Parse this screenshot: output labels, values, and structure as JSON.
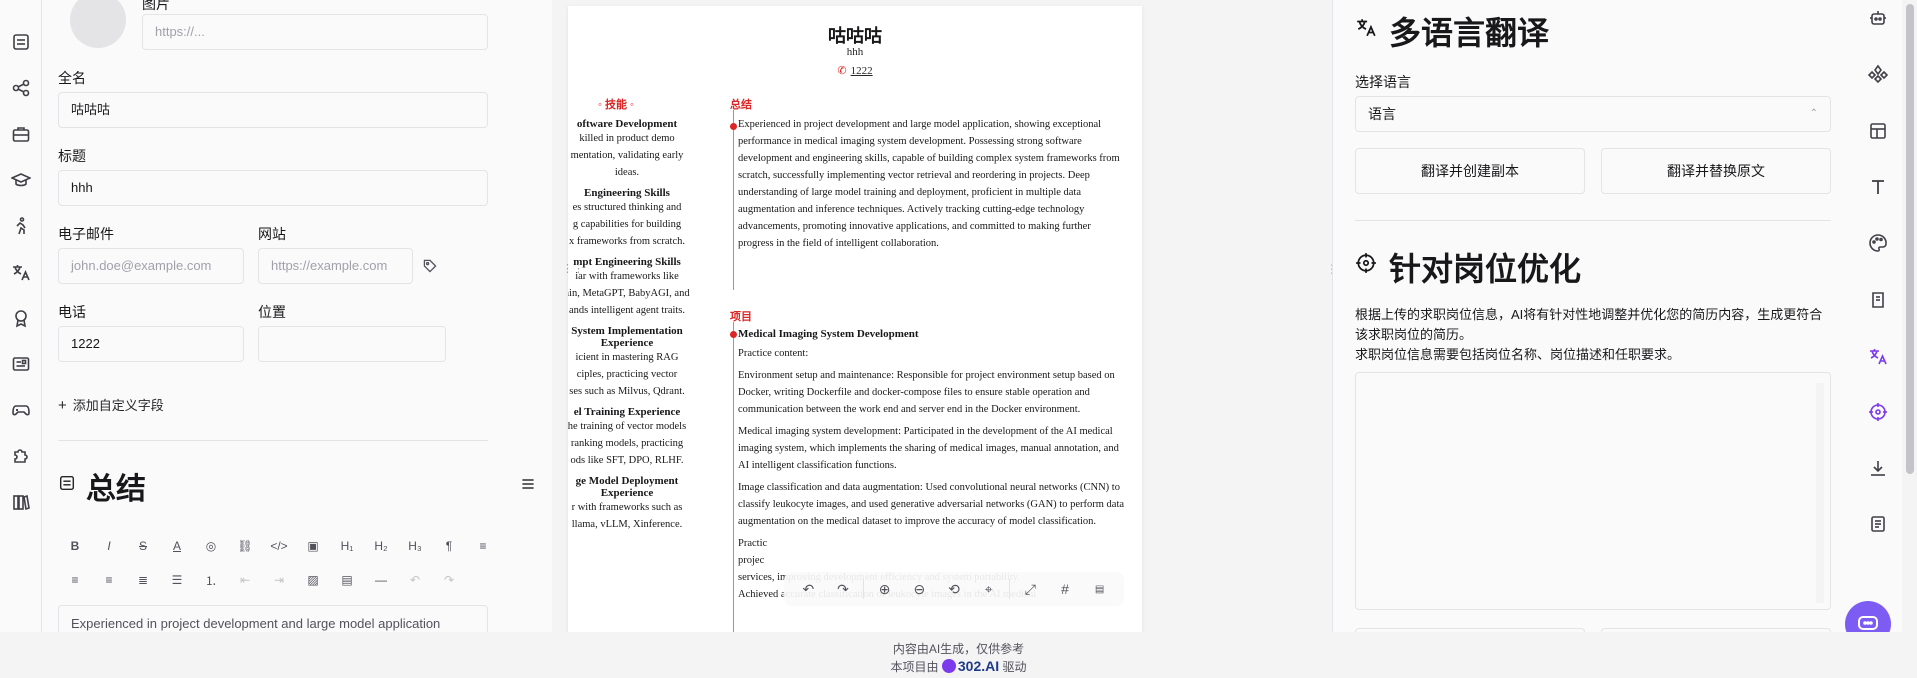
{
  "left_rail": {
    "icons": [
      "list-icon",
      "share-icon",
      "briefcase-icon",
      "graduation-cap-icon",
      "person-run-icon",
      "translate-icon",
      "award-icon",
      "news-icon",
      "gamepad-icon",
      "puzzle-icon",
      "books-icon"
    ]
  },
  "editor": {
    "image_label": "图片",
    "image_url_placeholder": "https://...",
    "fullname_label": "全名",
    "fullname_value": "咕咕咕",
    "title_label": "标题",
    "title_value": "hhh",
    "email_label": "电子邮件",
    "email_placeholder": "john.doe@example.com",
    "website_label": "网站",
    "website_placeholder": "https://example.com",
    "phone_label": "电话",
    "phone_value": "1222",
    "location_label": "位置",
    "location_value": "",
    "add_custom_field": "添加自定义字段",
    "summary_title": "总结",
    "summary_text": "Experienced in project development and large model application"
  },
  "resume": {
    "name": "咕咕咕",
    "title": "hhh",
    "phone": "1222",
    "skills_heading": "◦ 技能 ◦",
    "summary_heading": "总结",
    "projects_heading": "项目",
    "skills": [
      {
        "name": "oftware Development",
        "desc": "killed in product demo\nmentation, validating early\nideas."
      },
      {
        "name": "Engineering Skills",
        "desc": "es structured thinking and\ng capabilities for building\nx frameworks from scratch."
      },
      {
        "name": "mpt Engineering Skills",
        "desc": "iar with frameworks like\nain, MetaGPT, BabyAGI, and\nands intelligent agent traits."
      },
      {
        "name": "System Implementation\nExperience",
        "desc": "icient in mastering RAG\nciples, practicing vector\nses such as Milvus, Qdrant."
      },
      {
        "name": "el Training Experience",
        "desc": "he training of vector models\nranking models, practicing\nods like SFT, DPO, RLHF."
      },
      {
        "name": "ge Model Deployment\nExperience",
        "desc": "r with frameworks such as\nllama, vLLM, Xinference."
      }
    ],
    "summary": "Experienced in project development and large model application, showing exceptional performance in medical imaging system development. Possessing strong software development and engineering skills, capable of building complex system frameworks from scratch, successfully implementing vector retrieval and reordering in projects. Deep understanding of large model training and deployment, proficient in multiple data augmentation and inference techniques. Actively tracking cutting-edge technology advancements, promoting innovative applications, and committed to making further progress in the field of intelligent collaboration.",
    "project_title": "Medical Imaging System Development",
    "project_paragraphs": [
      "Practice content:",
      "Environment setup and maintenance: Responsible for project environment setup based on Docker, writing Dockerfile and docker-compose files to ensure stable operation and communication between the work end and server end in the Docker environment.",
      "Medical imaging system development: Participated in the development of the AI medical imaging system, which implements the sharing of medical images, manual annotation, and AI intelligent classification functions.",
      "Image classification and data augmentation: Used convolutional neural networks (CNN) to classify leukocyte images, and used generative adversarial networks (GAN) to perform data augmentation on the medical dataset to improve the accuracy of model classification.",
      "Practic",
      "projec",
      "services, improving development efficiency and system portability.",
      "Achieved accurate classification of leukocyte images in the AI medical"
    ]
  },
  "preview_toolbar": {
    "icons": [
      "undo-icon",
      "redo-icon",
      "zoom-in-icon",
      "zoom-out-icon",
      "reset-zoom-icon",
      "center-icon",
      "expand-icon",
      "grid-icon",
      "pdf-icon"
    ]
  },
  "right_panel": {
    "translate_title": "多语言翻译",
    "select_language_label": "选择语言",
    "language_select_value": "语言",
    "translate_copy_button": "翻译并创建副本",
    "translate_replace_button": "翻译并替换原文",
    "optimize_title": "针对岗位优化",
    "optimize_desc_1": "根据上传的求职岗位信息，AI将有针对性地调整并优化您的简历内容，生成更符合该求职岗位的简历。",
    "optimize_desc_2": "求职岗位信息需要包括岗位名称、岗位描述和任职要求。",
    "job_textarea_value": ""
  },
  "right_rail": {
    "icons": [
      "robot-icon",
      "diamond-icon",
      "layout-icon",
      "text-icon",
      "palette-icon",
      "notebook-icon",
      "translate-icon",
      "target-icon",
      "download-icon",
      "notes-icon"
    ],
    "active_color": "#7c3aed"
  },
  "footer": {
    "line1": "内容由AI生成，仅供参考",
    "line2_prefix": "本项目由",
    "brand": "302.AI",
    "line2_suffix": "驱动"
  },
  "colors": {
    "accent_red": "#dc2626",
    "accent_purple": "#7c3aed",
    "fab": "#7c5cf3"
  }
}
